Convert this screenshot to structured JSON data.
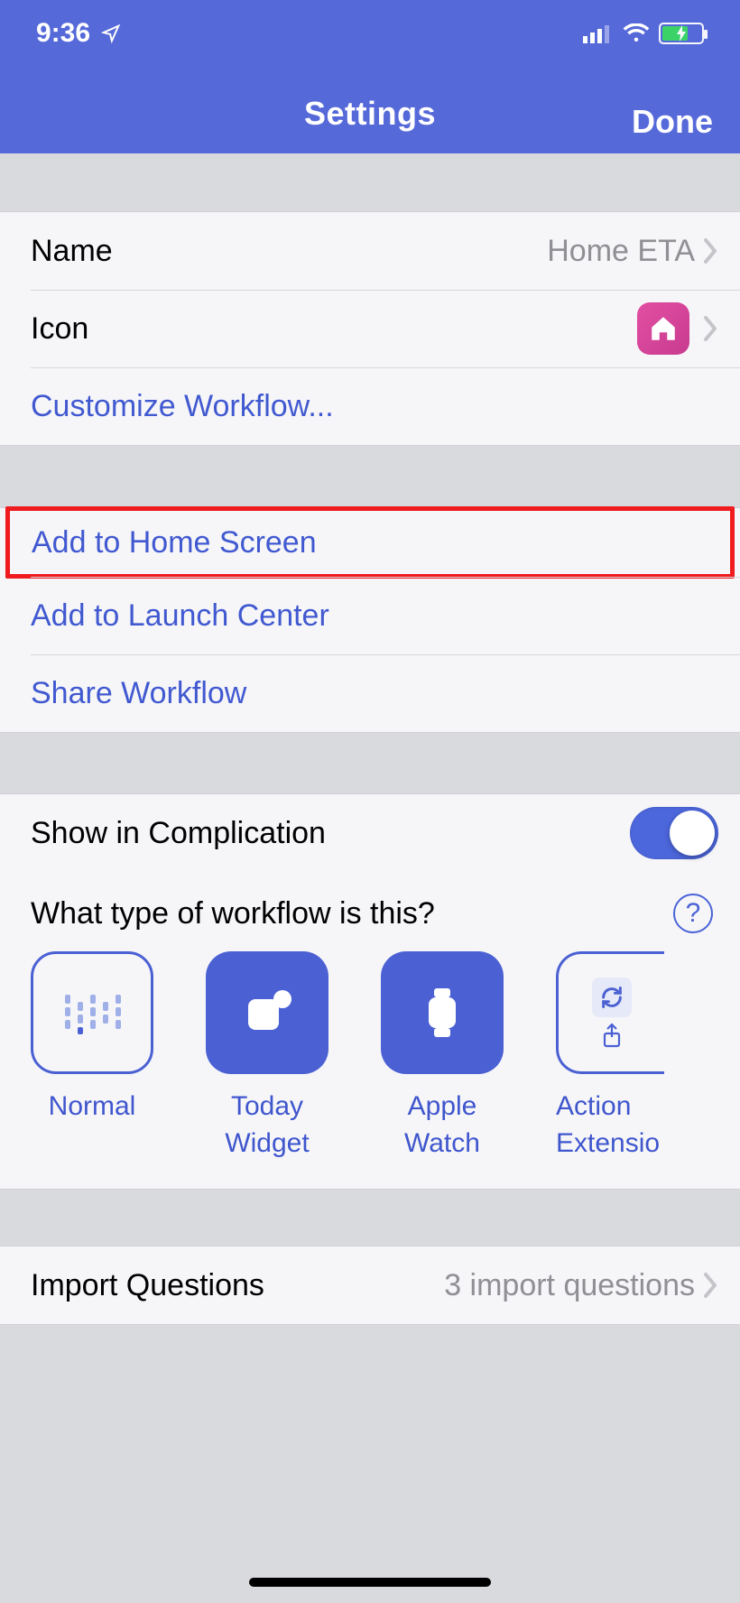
{
  "status": {
    "time": "9:36"
  },
  "nav": {
    "title": "Settings",
    "done": "Done"
  },
  "section1": {
    "name_label": "Name",
    "name_value": "Home ETA",
    "icon_label": "Icon",
    "customize": "Customize Workflow..."
  },
  "section2": {
    "add_home": "Add to Home Screen",
    "add_launch": "Add to Launch Center",
    "share": "Share Workflow"
  },
  "section3": {
    "complication_label": "Show in Complication",
    "type_question": "What type of workflow is this?",
    "types": [
      {
        "label": "Normal"
      },
      {
        "label": "Today\nWidget"
      },
      {
        "label": "Apple\nWatch"
      },
      {
        "label": "Action\nExtensio"
      }
    ]
  },
  "section4": {
    "import_label": "Import Questions",
    "import_value": "3 import questions"
  }
}
